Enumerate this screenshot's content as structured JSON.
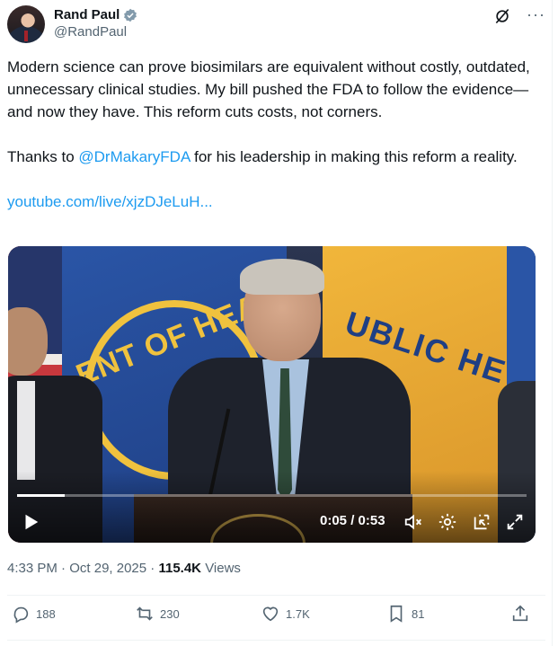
{
  "author": {
    "name": "Rand Paul",
    "handle": "@RandPaul"
  },
  "post": {
    "paragraph1": "Modern science can prove biosimilars are equivalent without costly, outdated, unnecessary clinical studies. My bill pushed the FDA to follow the evidence—and now they have. This reform cuts costs, not corners.",
    "paragraph2_prefix": "Thanks to ",
    "mention": "@DrMakaryFDA",
    "paragraph2_suffix": " for his leadership in making this reform a reality.",
    "link": "youtube.com/live/xjzDJeLuH..."
  },
  "video": {
    "time": "0:05 / 0:53",
    "progress_fraction": 0.094,
    "backdrop_text_left": "ENT OF HEA",
    "backdrop_text_right": "UBLIC HE"
  },
  "meta": {
    "time": "4:33 PM",
    "date": "Oct 29, 2025",
    "views_count": "115.4K",
    "views_label": "Views"
  },
  "actions": {
    "replies": "188",
    "reposts": "230",
    "likes": "1.7K",
    "bookmarks": "81"
  },
  "colors": {
    "accent": "#1d9bf0",
    "text": "#0f1419",
    "secondary": "#536471"
  }
}
